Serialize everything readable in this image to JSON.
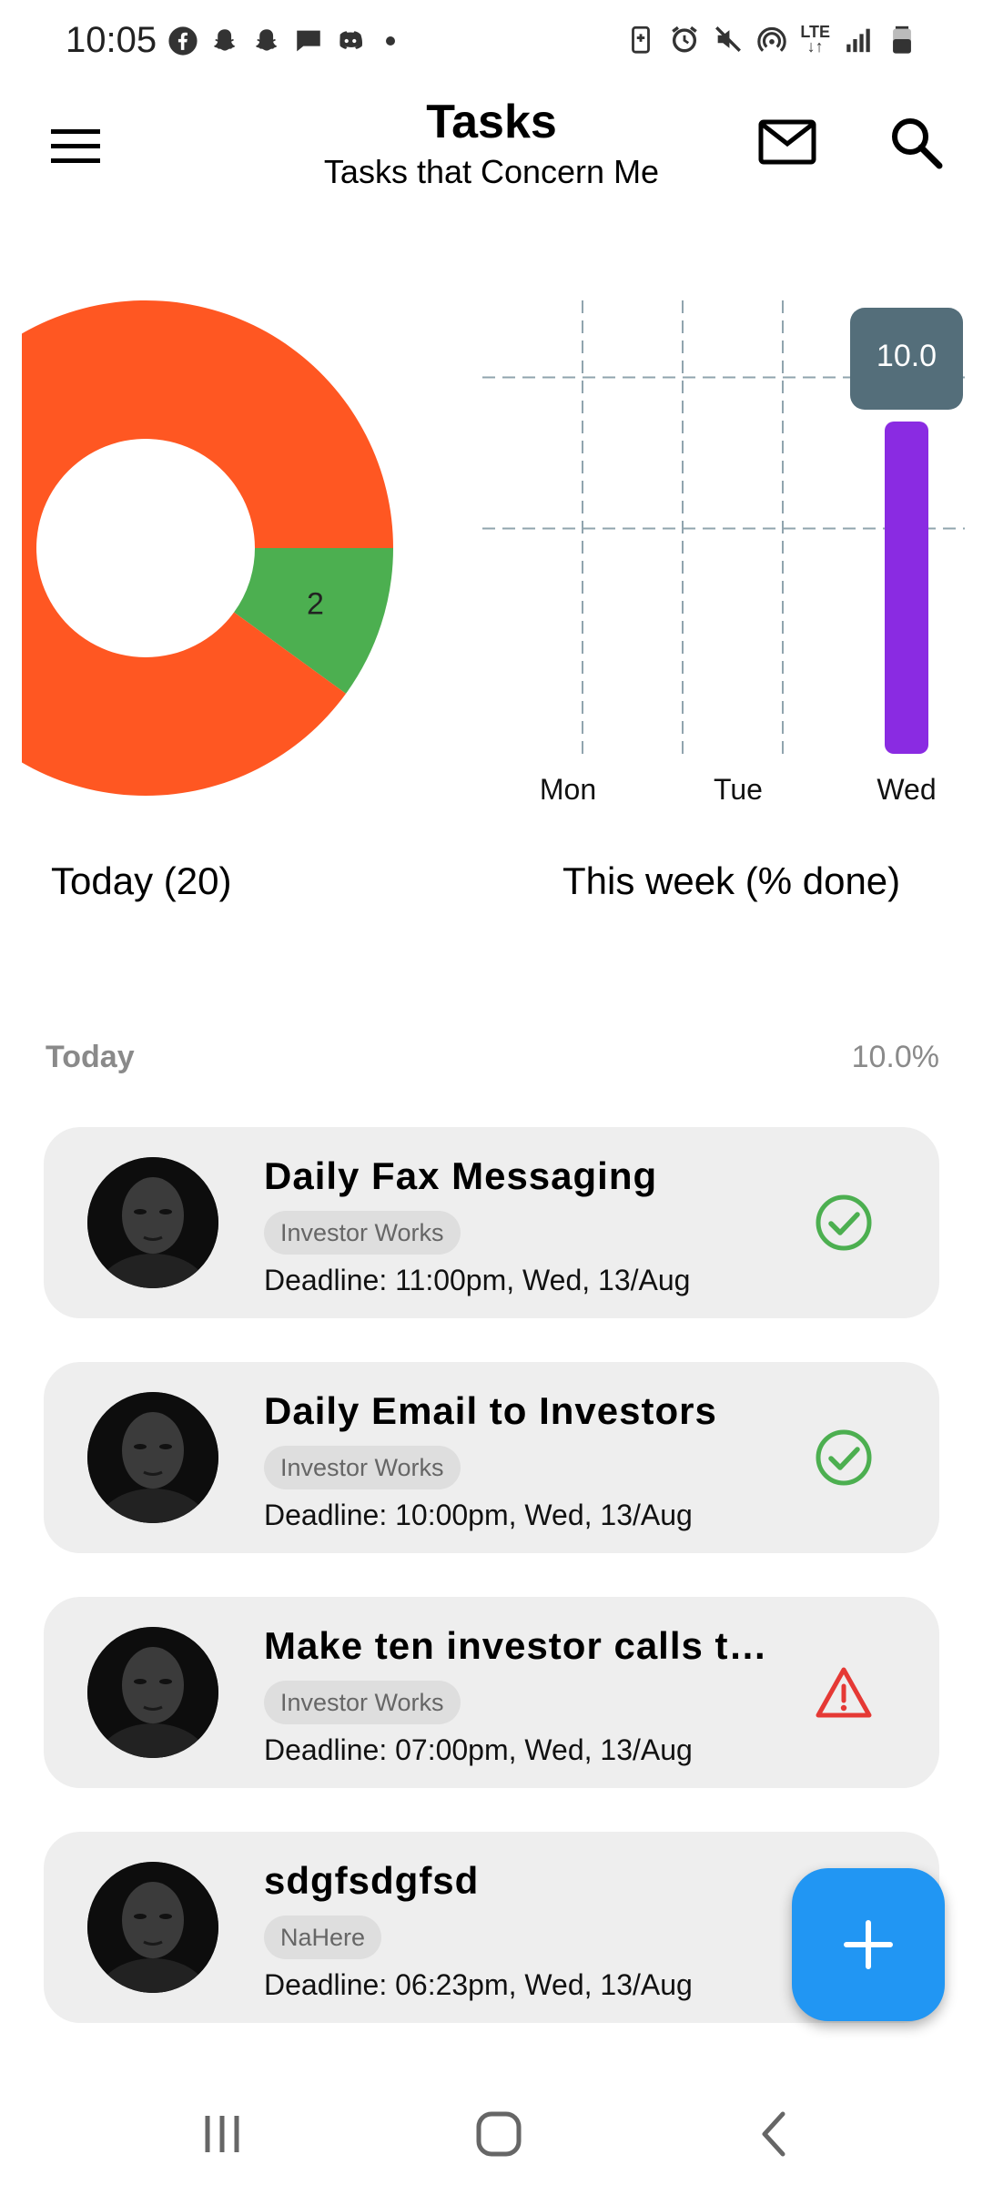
{
  "status_bar": {
    "time": "10:05",
    "left_icons": [
      "facebook-icon",
      "snapchat-icon",
      "snapchat-icon",
      "chat-icon",
      "discord-icon",
      "dot-icon"
    ],
    "right_icons": [
      "battery-saver-icon",
      "alarm-icon",
      "mute-icon",
      "hotspot-icon",
      "lte-icon",
      "signal-icon",
      "battery-icon"
    ],
    "network": "LTE"
  },
  "app_bar": {
    "title": "Tasks",
    "subtitle": "Tasks that Concern Me",
    "icons": [
      "menu-icon",
      "mail-icon",
      "search-icon"
    ]
  },
  "chart_data": [
    {
      "type": "pie",
      "variant": "donut",
      "caption": "Today (20)",
      "slices": [
        {
          "label": "",
          "value": 18,
          "color": "#ff5722"
        },
        {
          "label": "2",
          "value": 2,
          "color": "#4caf50"
        }
      ]
    },
    {
      "type": "bar",
      "caption": "This week (% done)",
      "categories": [
        "Mon",
        "Tue",
        "Wed"
      ],
      "values": [
        0,
        0,
        10.0
      ],
      "tooltip": "10.0",
      "ylim": [
        0,
        12
      ],
      "grid": true,
      "bar_color": "#8a2be2"
    }
  ],
  "charts": {
    "donut_label": "2",
    "week_tooltip": "10.0",
    "week_days": [
      "Mon",
      "Tue",
      "Wed"
    ],
    "today_caption": "Today (20)",
    "week_caption": "This week (% done)"
  },
  "section": {
    "title": "Today",
    "percent": "10.0%"
  },
  "tasks": [
    {
      "title": "Daily Fax Messaging",
      "tag": "Investor Works",
      "deadline": "Deadline: 11:00pm, Wed, 13/Aug",
      "status": "done"
    },
    {
      "title": "Daily Email to Investors",
      "tag": "Investor Works",
      "deadline": "Deadline: 10:00pm, Wed, 13/Aug",
      "status": "done"
    },
    {
      "title": "Make ten investor calls t…",
      "tag": "Investor Works",
      "deadline": "Deadline: 07:00pm, Wed, 13/Aug",
      "status": "warning"
    },
    {
      "title": "sdgfsdgfsd",
      "tag": "NaHere",
      "deadline": "Deadline: 06:23pm, Wed, 13/Aug",
      "status": "none"
    }
  ],
  "colors": {
    "orange": "#ff5722",
    "green": "#4caf50",
    "purple": "#8a2be2",
    "tooltip": "#546e7a",
    "fab": "#2196f3",
    "warning": "#e53935"
  },
  "fab": {
    "icon": "plus-icon"
  },
  "nav_bar": {
    "icons": [
      "recent-apps-icon",
      "home-icon",
      "back-icon"
    ]
  }
}
